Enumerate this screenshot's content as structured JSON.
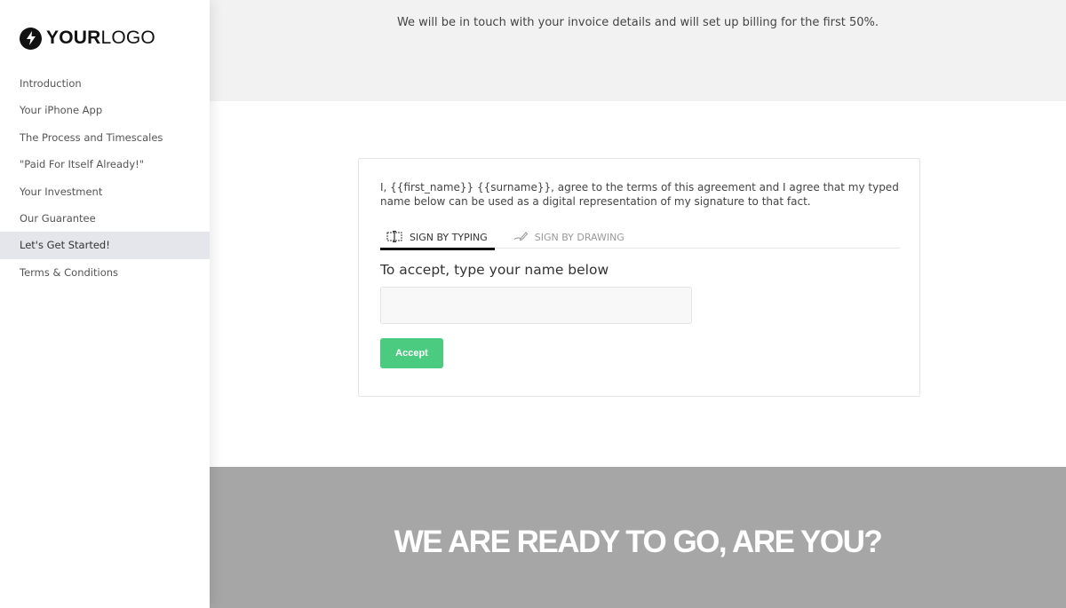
{
  "logo": {
    "bold": "YOUR",
    "light": "LOGO",
    "icon": "lightning-bolt-icon"
  },
  "sidebar": {
    "items": [
      {
        "label": "Introduction",
        "active": false
      },
      {
        "label": "Your iPhone App",
        "active": false
      },
      {
        "label": "The Process and Timescales",
        "active": false
      },
      {
        "label": "\"Paid For Itself Already!\"",
        "active": false
      },
      {
        "label": "Your Investment",
        "active": false
      },
      {
        "label": "Our Guarantee",
        "active": false
      },
      {
        "label": "Let's Get Started!",
        "active": true
      },
      {
        "label": "Terms & Conditions",
        "active": false
      }
    ]
  },
  "top_band": {
    "text": "We will be in touch with your invoice details and will set up billing for the first 50%."
  },
  "signature": {
    "agreement": "I, {{first_name}} {{surname}}, agree to the terms of this agreement and I agree that my typed name below can be used as a digital representation of my signature to that fact.",
    "tabs": [
      {
        "label": "SIGN BY TYPING",
        "icon": "keyboard-cursor-icon",
        "active": true
      },
      {
        "label": "SIGN BY DRAWING",
        "icon": "pen-icon",
        "active": false
      }
    ],
    "field_label": "To accept, type your name below",
    "input_value": "",
    "input_placeholder": "",
    "accept_label": "Accept",
    "accent_color": "#4bcb80"
  },
  "cta": {
    "text": "WE ARE READY TO GO, ARE YOU?"
  }
}
